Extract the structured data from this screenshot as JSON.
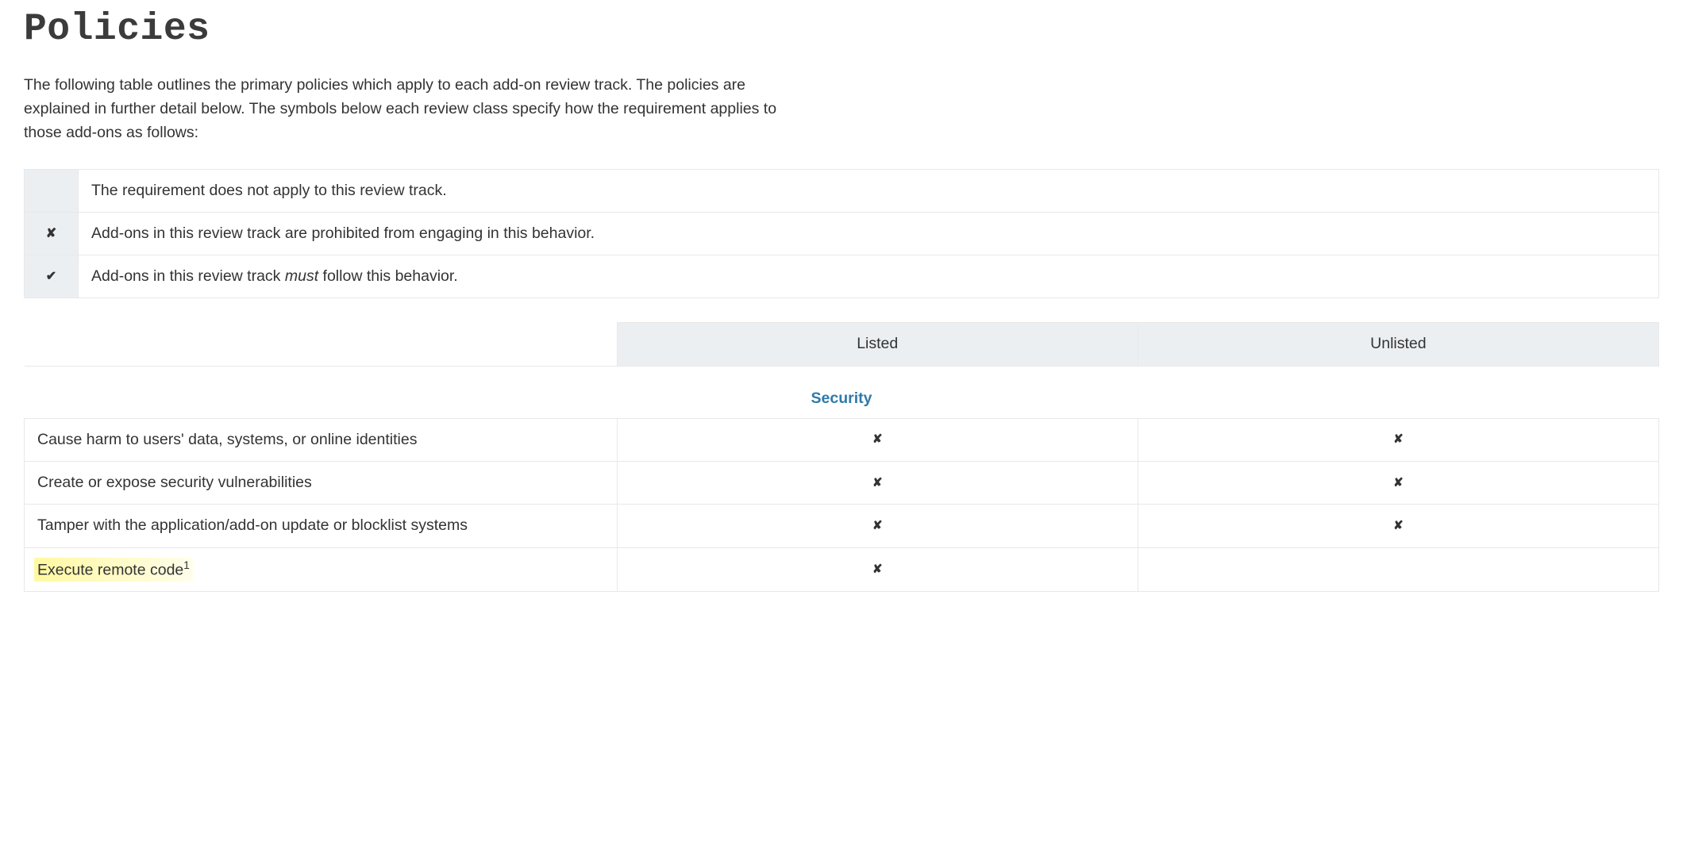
{
  "title": "Policies",
  "intro": "The following table outlines the primary policies which apply to each add-on review track. The policies are explained in further detail below. The symbols below each review class specify how the requirement applies to those add-ons as follows:",
  "legend": [
    {
      "symbol": "",
      "desc": "The requirement does not apply to this review track."
    },
    {
      "symbol": "✘",
      "desc": "Add-ons in this review track are prohibited from engaging in this behavior."
    },
    {
      "symbol": "✔",
      "desc_prefix": "Add-ons in this review track ",
      "desc_italic": "must",
      "desc_suffix": " follow this behavior."
    }
  ],
  "policyTable": {
    "headers": {
      "col1": "Listed",
      "col2": "Unlisted"
    },
    "section": "Security",
    "rows": [
      {
        "label": "Cause harm to users' data, systems, or online identities",
        "listed": "✘",
        "unlisted": "✘",
        "highlight": false,
        "sup": ""
      },
      {
        "label": "Create or expose security vulnerabilities",
        "listed": "✘",
        "unlisted": "✘",
        "highlight": false,
        "sup": ""
      },
      {
        "label": "Tamper with the application/add-on update or blocklist systems",
        "listed": "✘",
        "unlisted": "✘",
        "highlight": false,
        "sup": ""
      },
      {
        "label": "Execute remote code",
        "listed": "✘",
        "unlisted": "",
        "highlight": true,
        "sup": "1"
      }
    ]
  }
}
